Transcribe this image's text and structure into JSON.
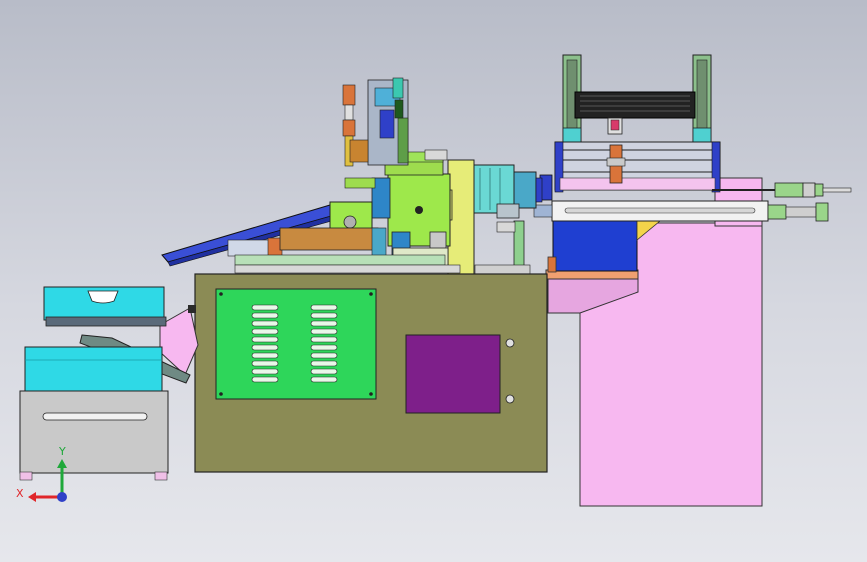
{
  "view": {
    "background_top": "#b8bcc8",
    "background_bottom": "#e6e7ec"
  },
  "triad": {
    "x_label": "X",
    "y_label": "Y",
    "x_color": "#e0262a",
    "y_color": "#1fa83a",
    "z_color": "#2f40c8"
  },
  "model": {
    "name": "",
    "parts": [
      "feed-bin-upper",
      "feed-bin-lower",
      "bin-base-cabinet",
      "main-cabinet",
      "vent-panel",
      "access-panel",
      "chute",
      "feeder-ramp",
      "spindle-assembly",
      "motor-housing",
      "tensioner-frame",
      "roller-stack",
      "slide-rail",
      "pneumatic-cylinder",
      "right-column",
      "blue-block",
      "support-bracket"
    ],
    "colors": {
      "cabinet": "#8b8b55",
      "vent_panel": "#2ed65a",
      "access_panel": "#7e1f8a",
      "bin_teal": "#2fd9e6",
      "bin_base": "#c9c9c9",
      "column": "#f7b8f0",
      "spindle_green": "#9ee84b",
      "spindle_yellow": "#e6ec78",
      "motor_teal": "#6ad8d4",
      "blue_block": "#1f3fd1",
      "copper": "#d9743a",
      "orange_base": "#f0a070"
    }
  }
}
